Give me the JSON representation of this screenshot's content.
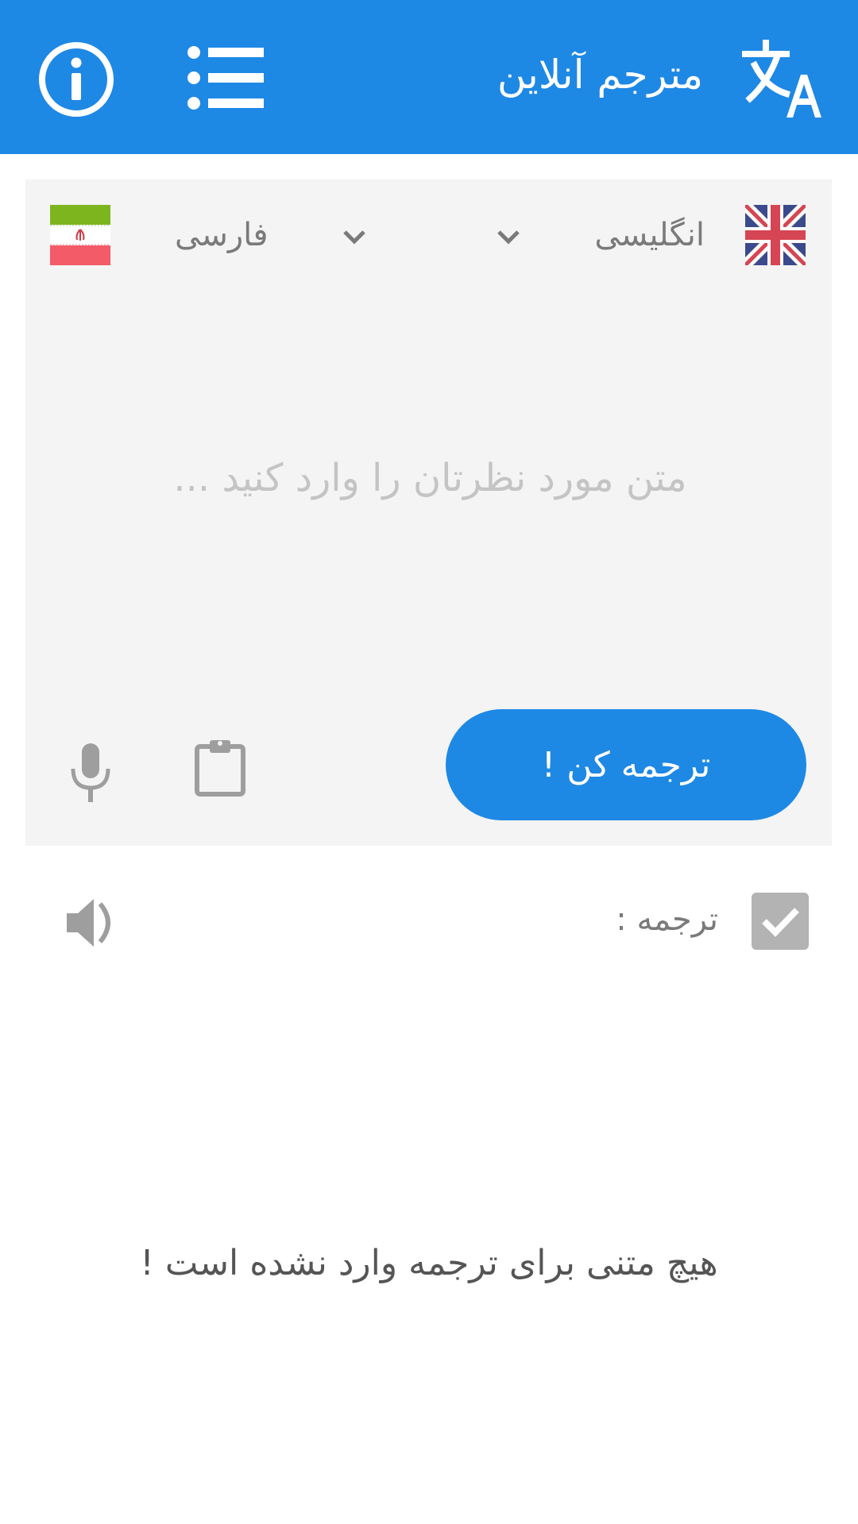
{
  "app_bar": {
    "title": "مترجم آنلاین",
    "icons": {
      "info": "info-icon",
      "menu": "menu-list-icon",
      "brand": "translate-icon"
    }
  },
  "language_selector": {
    "source_language": "انگلیسی",
    "target_language": "فارسی",
    "source_flag": "uk-flag-icon",
    "target_flag": "iran-flag-icon"
  },
  "input": {
    "value": "",
    "placeholder": "متن مورد نظرتان را وارد کنید ..."
  },
  "actions": {
    "translate_label": "ترجمه کن !",
    "paste_icon": "clipboard-icon",
    "voice_icon": "mic-icon"
  },
  "result": {
    "label": "ترجمه :",
    "checked": true,
    "speaker_icon": "speaker-icon",
    "empty_message": "هیچ متنی برای ترجمه وارد نشده است !"
  },
  "colors": {
    "primary": "#1e88e5",
    "card_background": "#f4f4f4",
    "muted_text": "#7a7a7a",
    "placeholder_text": "#c4c4c4",
    "icon_gray": "#9e9e9e"
  }
}
